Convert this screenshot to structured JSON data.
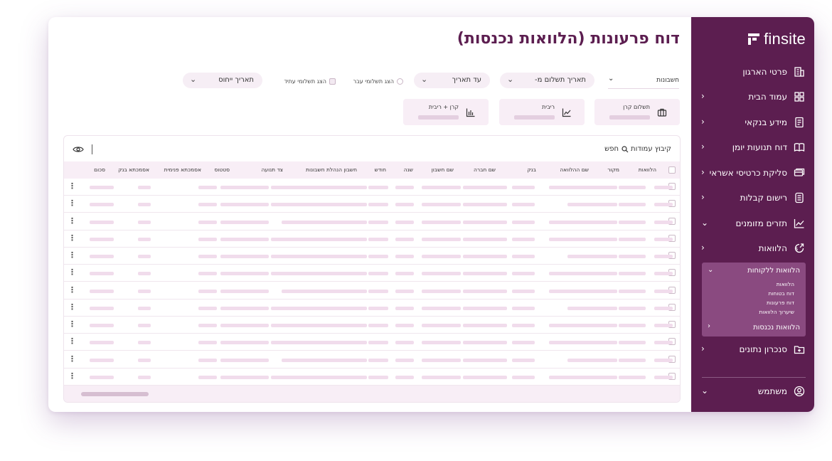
{
  "app": {
    "brand": "finsite",
    "brand_color": "#5c1e50"
  },
  "page": {
    "title": "דוח פרעונות (הלוואות נכנסות)"
  },
  "filters": {
    "accounts_label": "חשבונות",
    "payment_date_from": "תאריך תשלום מ-",
    "to_date": "עד תאריך",
    "show_past_payments": "הצג תשלומי עבר",
    "show_future_payments": "הצג תשלומי עתיד",
    "attribution_date": "תאריך ייחוס"
  },
  "kpis": [
    {
      "label": "תשלום קרן",
      "icon": "briefcase-icon"
    },
    {
      "label": "ריבית",
      "icon": "trend-line-icon"
    },
    {
      "label": "קרן + ריבית",
      "icon": "bar-chart-icon"
    }
  ],
  "table": {
    "toolbar": {
      "group_columns": "קיבוץ עמודות",
      "search": "חפש"
    },
    "columns": [
      "הלוואות",
      "מקור",
      "שם ההלוואה",
      "בנק",
      "שם חברה",
      "שם חשבון",
      "שנה",
      "חודש",
      "חשבון הנהלת חשבונות",
      "צד תנועה",
      "סטטוס",
      "אסמכתא פנימית",
      "אסמכתא בנק",
      "סכום"
    ],
    "row_count": 12
  },
  "sidebar": {
    "items": [
      {
        "label": "פרטי הארגון",
        "icon": "building-icon",
        "chevron": ""
      },
      {
        "label": "עמוד הבית",
        "icon": "dashboard-icon",
        "chevron": "‹"
      },
      {
        "label": "מידע בנקאי",
        "icon": "bank-doc-icon",
        "chevron": "‹"
      },
      {
        "label": "דוח תנועות יומן",
        "icon": "book-icon",
        "chevron": "‹"
      },
      {
        "label": "סליקת כרטיסי אשראי",
        "icon": "credit-card-icon",
        "chevron": "‹"
      },
      {
        "label": "רישום קבלות",
        "icon": "receipt-icon",
        "chevron": "‹"
      },
      {
        "label": "תזרים מזומנים",
        "icon": "cashflow-icon",
        "chevron": "⌄"
      },
      {
        "label": "הלוואות",
        "icon": "loan-icon",
        "chevron": "‹"
      }
    ],
    "loans_sub": {
      "header": "הלוואות ללקוחות",
      "links": [
        "הלוואות",
        "דוח בטוחות",
        "דוח פרעונות",
        "שיערוך הלוואות"
      ],
      "last": "הלוואות נכנסות"
    },
    "sync": {
      "label": "סנכרון נתונים",
      "icon": "folder-sync-icon"
    },
    "user": {
      "label": "משתמש",
      "icon": "user-icon"
    }
  }
}
